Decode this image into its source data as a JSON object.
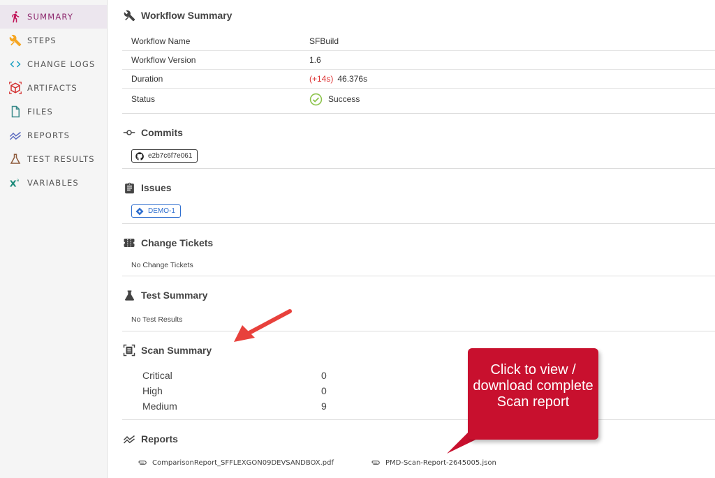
{
  "sidebar": {
    "items": [
      {
        "label": "SUMMARY",
        "icon": "run-icon",
        "active": true
      },
      {
        "label": "STEPS",
        "icon": "tools-icon",
        "active": false
      },
      {
        "label": "CHANGE LOGS",
        "icon": "code-icon",
        "active": false
      },
      {
        "label": "ARTIFACTS",
        "icon": "artifact-icon",
        "active": false
      },
      {
        "label": "FILES",
        "icon": "file-icon",
        "active": false
      },
      {
        "label": "REPORTS",
        "icon": "chart-line-icon",
        "active": false
      },
      {
        "label": "TEST RESULTS",
        "icon": "flask-icon",
        "active": false
      },
      {
        "label": "VARIABLES",
        "icon": "variable-icon",
        "active": false
      }
    ]
  },
  "workflow_summary": {
    "title": "Workflow Summary",
    "rows": [
      {
        "key": "Workflow Name",
        "value": "SFBuild"
      },
      {
        "key": "Workflow Version",
        "value": "1.6"
      },
      {
        "key": "Duration",
        "delta": "(+14s)",
        "value": "46.376s"
      },
      {
        "key": "Status",
        "value": "Success"
      }
    ]
  },
  "commits": {
    "title": "Commits",
    "items": [
      "e2b7c6f7e061"
    ]
  },
  "issues": {
    "title": "Issues",
    "items": [
      "DEMO-1"
    ]
  },
  "change_tickets": {
    "title": "Change Tickets",
    "empty": "No Change Tickets"
  },
  "test_summary": {
    "title": "Test Summary",
    "empty": "No Test Results"
  },
  "scan_summary": {
    "title": "Scan Summary",
    "rows": [
      {
        "label": "Critical",
        "value": "0"
      },
      {
        "label": "High",
        "value": "0"
      },
      {
        "label": "Medium",
        "value": "9"
      }
    ]
  },
  "reports": {
    "title": "Reports",
    "files": [
      "ComparisonReport_SFFLEXGON09DEVSANDBOX.pdf",
      "PMD-Scan-Report-2645005.json"
    ]
  },
  "annotation": {
    "callout_text": "Click to view / download complete Scan report"
  },
  "colors": {
    "accent": "#8e2a6f",
    "success": "#8bc34a",
    "delta": "#dd3333",
    "callout": "#c8102e",
    "arrow": "#e8413c",
    "issue": "#2f6fcf"
  }
}
